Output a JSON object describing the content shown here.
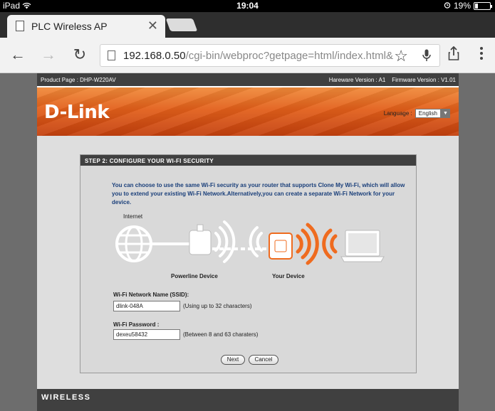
{
  "status_bar": {
    "device": "iPad",
    "time": "19:04",
    "battery": "19%",
    "battery_level": 0.19
  },
  "browser": {
    "tab_title": "PLC Wireless AP",
    "url_host": "192.168.0.50",
    "url_path": "/cgi-bin/webproc?getpage=html/index.html&"
  },
  "page": {
    "product_page": "Product Page : DHP-W220AV",
    "hardware_version": "Hareware Version : A1",
    "firmware_version": "Firmware Version : V1.01",
    "logo": "D-Link",
    "language_label": "Language :",
    "language_value": "English",
    "step_title": "STEP 2: CONFIGURE YOUR WI-FI SECURITY",
    "description": "You can choose to use the same Wi-Fi security as your router that supports Clone My Wi-Fi, which will allow you to extend your existing Wi-Fi Network.Alternatively,you can create a separate Wi-Fi Network for your device.",
    "diagram": {
      "internet_label": "Internet",
      "powerline_label": "Powerline Device",
      "your_device_label": "Your Device"
    },
    "ssid_label": "Wi-Fi Network Name (SSID):",
    "ssid_value": "dlink-048A",
    "ssid_hint": "(Using up to 32 characters)",
    "password_label": "Wi-Fi Password :",
    "password_value": "dexeu58432",
    "password_hint": "(Between 8 and 63 charaters)",
    "next_button": "Next",
    "cancel_button": "Cancel",
    "footer_text": "WIRELESS"
  },
  "colors": {
    "accent_orange": "#ef6b1f",
    "dark_bar": "#404040",
    "description_blue": "#1a3f7a"
  }
}
